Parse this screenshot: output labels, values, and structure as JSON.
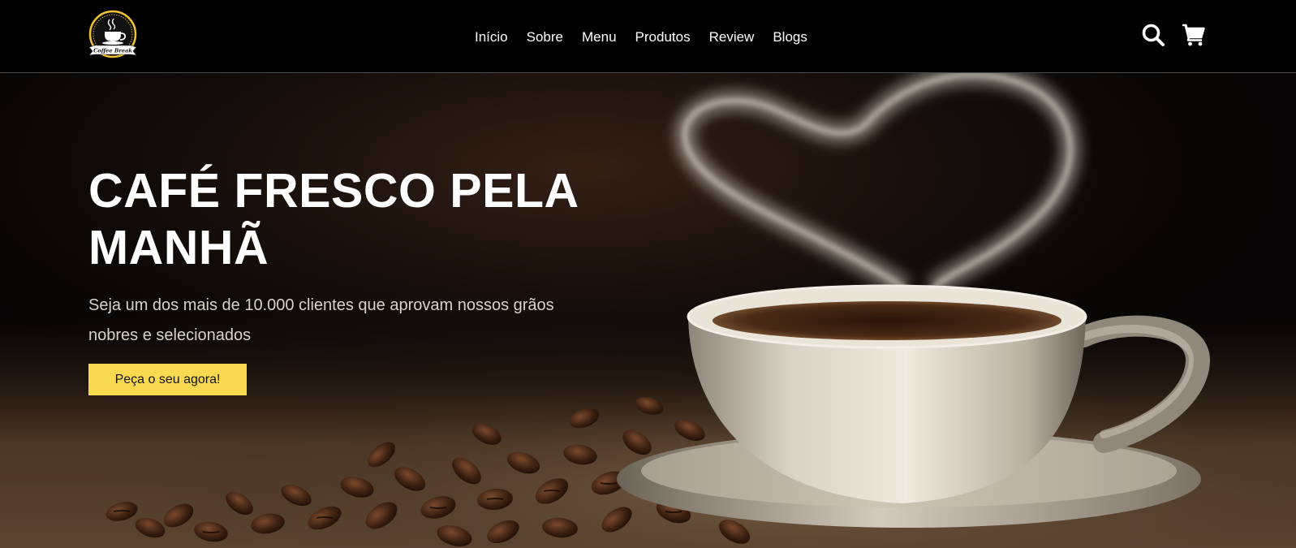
{
  "brand": {
    "logo_text": "Coffee Break",
    "logo_icon": "coffee-cup-icon"
  },
  "nav": {
    "links": [
      {
        "label": "Início"
      },
      {
        "label": "Sobre"
      },
      {
        "label": "Menu"
      },
      {
        "label": "Produtos"
      },
      {
        "label": "Review"
      },
      {
        "label": "Blogs"
      }
    ],
    "icons": [
      "search-icon",
      "cart-icon"
    ]
  },
  "hero": {
    "title": "CAFÉ FRESCO PELA MANHÃ",
    "subtitle": "Seja um dos mais de 10.000 clientes que aprovam nossos grãos nobres e selecionados",
    "cta_label": "Peça o seu agora!"
  },
  "colors": {
    "accent": "#f8d94f",
    "background": "#000000",
    "text": "#ffffff"
  }
}
